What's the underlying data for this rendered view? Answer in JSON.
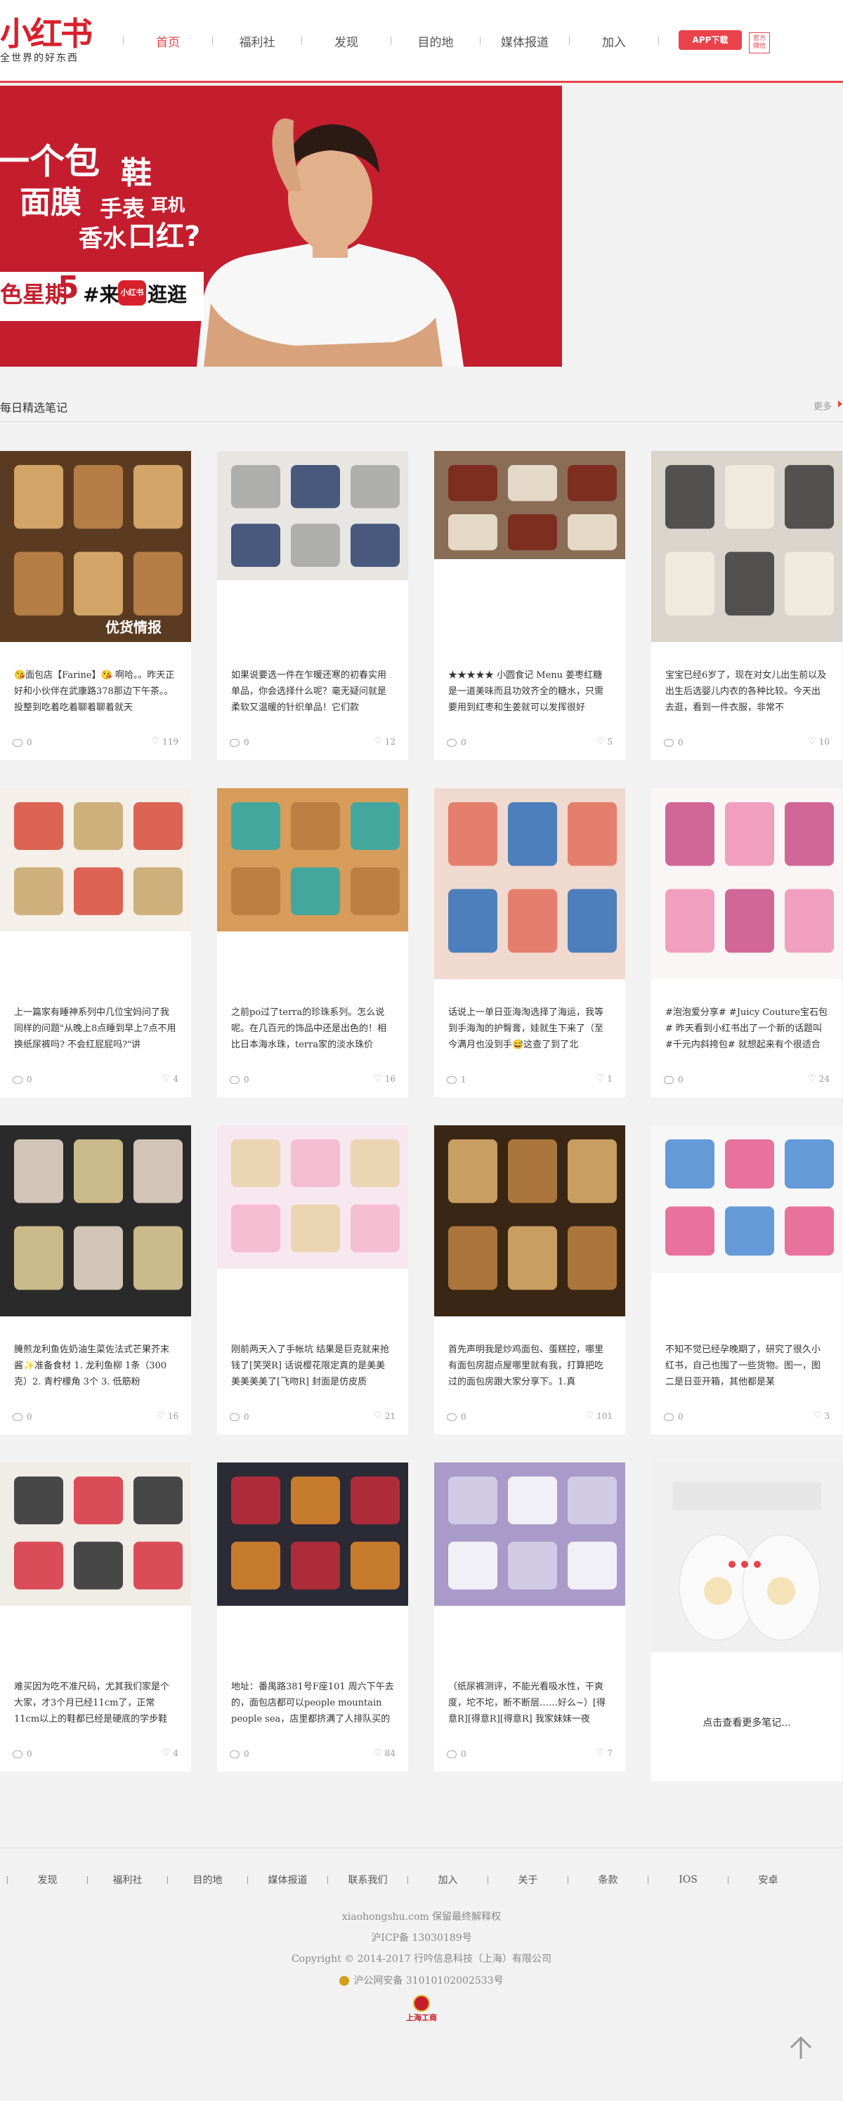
{
  "header": {
    "logo": "小红书",
    "slogan": "全世界的好东西",
    "nav": [
      "首页",
      "福利社",
      "发现",
      "目的地",
      "媒体报道",
      "加入"
    ],
    "active_nav": "首页",
    "app_button": "APP下载",
    "qr_label": "官方\n微信",
    "accent": "#e9424b"
  },
  "banner": {
    "line1a": "一个包",
    "line1b": "鞋",
    "line2a": "面膜",
    "line2b": "手表",
    "line2c": "耳机",
    "line3a": "香水",
    "line3b": "口红?",
    "line4a": "色星期",
    "line4b": "5",
    "line4c": "#来",
    "line4d": "小红书",
    "line4e": "逛逛",
    "bg_color": "#c41e2e"
  },
  "section": {
    "title": "每日精选笔记",
    "more": "更多"
  },
  "notes": [
    {
      "text": "😘面包店【Farine】😘 啊哈。。昨天正好和小伙伴在武康路378那边下午茶。。投整到吃着吃着聊着聊着就天",
      "comments": "0",
      "likes": "119",
      "image": "bakery-bread",
      "watermark": "优货情报"
    },
    {
      "text": "如果说要选一件在乍暖还寒的初春实用单品，你会选择什么呢？毫无疑问就是柔软又温暖的针织单品！它们款",
      "comments": "0",
      "likes": "12",
      "image": "fashion-knitwear"
    },
    {
      "text": "★★★★★ 小圆食记 Menu 姜枣红糖是一道美味而且功效齐全的糖水，只需要用到红枣和生姜就可以发挥很好",
      "comments": "0",
      "likes": "5",
      "image": "ginger-date-drink"
    },
    {
      "text": "宝宝已经6岁了，现在对女儿出生前以及出生后选婴儿内衣的各种比较。今天出去逛，看到一件衣服，非常不",
      "comments": "0",
      "likes": "10",
      "image": "baby-clothes"
    },
    {
      "text": "上一篇家有睡神系列中几位宝妈问了我同样的问题\"从晚上8点睡到早上7点不用换纸尿裤吗? 不会红屁屁吗?\"讲",
      "comments": "0",
      "likes": "4",
      "image": "baby-skincare"
    },
    {
      "text": "之前po过了terra的珍珠系列。怎么说呢。在几百元的饰品中还是出色的！相比日本海水珠，terra家的淡水珠价",
      "comments": "0",
      "likes": "16",
      "image": "turquoise-earrings"
    },
    {
      "text": "话说上一单日亚海淘选择了海运，我等到手海淘的护臀膏，娃就生下来了（至今满月也没到手😅这查了到了北",
      "comments": "1",
      "likes": "1",
      "image": "desitin-cream"
    },
    {
      "text": "#泡泡爱分享# #Juicy Couture宝石包# 昨天看到小红书出了一个新的话题叫#千元内斜挎包# 就想起来有个很适合",
      "comments": "0",
      "likes": "24",
      "image": "pink-bag"
    },
    {
      "text": "腌煎龙利鱼佐奶油生菜佐法式芒果芥末酱✨准备食材 1. 龙利鱼柳 1条（300克）2. 青柠檬角 3个 3. 低筋粉",
      "comments": "0",
      "likes": "16",
      "image": "fish-prep"
    },
    {
      "text": "刚前两天入了手帐坑 结果是巨克就来抢钱了[笑哭R] 话说樱花限定真的是美美美美美美了[飞吻R] 封面是仿皮质",
      "comments": "0",
      "likes": "21",
      "image": "sakura-notebook"
    },
    {
      "text": "首先声明我是炒鸡面包、蛋糕控，哪里有面包房甜点屋哪里就有我，打算把吃过的面包房跟大家分享下。1.真",
      "comments": "0",
      "likes": "101",
      "image": "bakery-display"
    },
    {
      "text": "不知不觉已经孕晚期了，研究了很久小红书，自己也囤了一些货物。图一，图二是日亚开箱，其他都是某",
      "comments": "0",
      "likes": "3",
      "image": "baby-products"
    },
    {
      "text": "难买因为吃不准尺码，尤其我们家是个大家，才3个月已经11cm了，正常11cm以上的鞋都已经是硬底的学步鞋",
      "comments": "0",
      "likes": "4",
      "image": "baby-shoes"
    },
    {
      "text": "地址：番禺路381号F座101 周六下午去的，面包店都可以people mountain people sea，店里都挤满了人排队买的",
      "comments": "0",
      "likes": "84",
      "image": "tarts"
    },
    {
      "text": "（纸尿裤测评，不能光看吸水性，干爽度，坨不坨，断不断层……好么~）[得意R][得意R][得意R] 我家妹妹一夜",
      "comments": "0",
      "likes": "7",
      "image": "diapers"
    }
  ],
  "more_notes": "点击查看更多笔记...",
  "footer": {
    "nav": [
      "发现",
      "福利社",
      "目的地",
      "媒体报道",
      "联系我们",
      "加入",
      "关于",
      "条款",
      "IOS",
      "安卓"
    ],
    "domain": "xiaohongshu.com 保留最终解释权",
    "icp": "沪ICP备 13030189号",
    "copyright": "Copyright © 2014-2017 行吟信息科技（上海）有限公司",
    "police": "沪公网安备 31010102002533号",
    "emblem": "上海工商"
  }
}
